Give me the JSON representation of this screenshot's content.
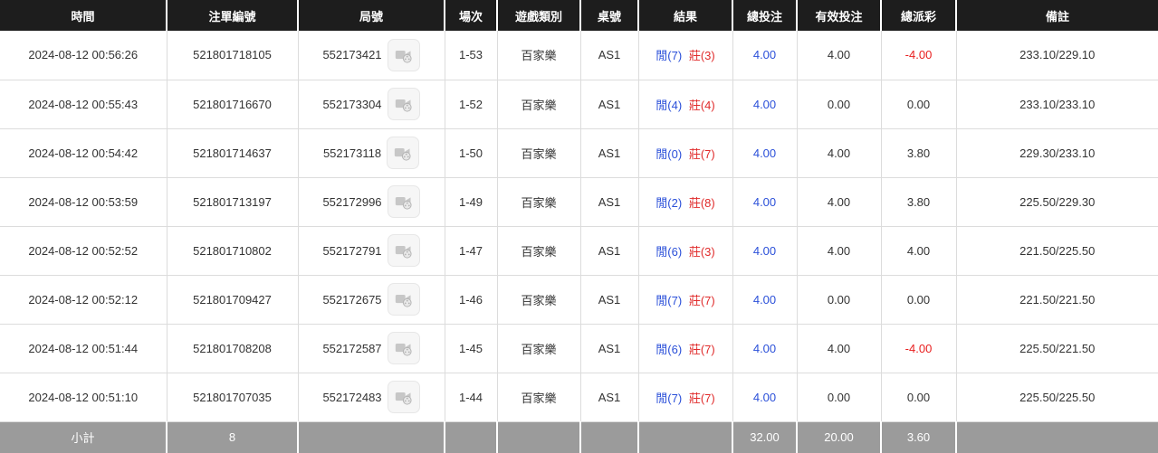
{
  "colors": {
    "header_bg": "#1d1d1d",
    "footer_bg": "#9b9b9b",
    "player_blue": "#2b50d9",
    "banker_red": "#e02b2b",
    "negative_red": "#e81e1e",
    "grid_line": "#dcdcdc"
  },
  "icons": {
    "video_replay": "video-camera-icon"
  },
  "table": {
    "columns": [
      {
        "label": "時間"
      },
      {
        "label": "注單編號"
      },
      {
        "label": "局號"
      },
      {
        "label": "場次"
      },
      {
        "label": "遊戲類別"
      },
      {
        "label": "桌號"
      },
      {
        "label": "結果"
      },
      {
        "label": "總投注"
      },
      {
        "label": "有效投注"
      },
      {
        "label": "總派彩"
      },
      {
        "label": "備註"
      }
    ],
    "rows": [
      {
        "time": "2024-08-12 00:56:26",
        "bet_id": "521801718105",
        "round_id": "552173421",
        "session": "1-53",
        "game_type": "百家樂",
        "table_no": "AS1",
        "result_player": "閒(7)",
        "result_banker": "莊(3)",
        "total_bet": "4.00",
        "valid_bet": "4.00",
        "total_payout": "-4.00",
        "remark": "233.10/229.10"
      },
      {
        "time": "2024-08-12 00:55:43",
        "bet_id": "521801716670",
        "round_id": "552173304",
        "session": "1-52",
        "game_type": "百家樂",
        "table_no": "AS1",
        "result_player": "閒(4)",
        "result_banker": "莊(4)",
        "total_bet": "4.00",
        "valid_bet": "0.00",
        "total_payout": "0.00",
        "remark": "233.10/233.10"
      },
      {
        "time": "2024-08-12 00:54:42",
        "bet_id": "521801714637",
        "round_id": "552173118",
        "session": "1-50",
        "game_type": "百家樂",
        "table_no": "AS1",
        "result_player": "閒(0)",
        "result_banker": "莊(7)",
        "total_bet": "4.00",
        "valid_bet": "4.00",
        "total_payout": "3.80",
        "remark": "229.30/233.10"
      },
      {
        "time": "2024-08-12 00:53:59",
        "bet_id": "521801713197",
        "round_id": "552172996",
        "session": "1-49",
        "game_type": "百家樂",
        "table_no": "AS1",
        "result_player": "閒(2)",
        "result_banker": "莊(8)",
        "total_bet": "4.00",
        "valid_bet": "4.00",
        "total_payout": "3.80",
        "remark": "225.50/229.30"
      },
      {
        "time": "2024-08-12 00:52:52",
        "bet_id": "521801710802",
        "round_id": "552172791",
        "session": "1-47",
        "game_type": "百家樂",
        "table_no": "AS1",
        "result_player": "閒(6)",
        "result_banker": "莊(3)",
        "total_bet": "4.00",
        "valid_bet": "4.00",
        "total_payout": "4.00",
        "remark": "221.50/225.50"
      },
      {
        "time": "2024-08-12 00:52:12",
        "bet_id": "521801709427",
        "round_id": "552172675",
        "session": "1-46",
        "game_type": "百家樂",
        "table_no": "AS1",
        "result_player": "閒(7)",
        "result_banker": "莊(7)",
        "total_bet": "4.00",
        "valid_bet": "0.00",
        "total_payout": "0.00",
        "remark": "221.50/221.50"
      },
      {
        "time": "2024-08-12 00:51:44",
        "bet_id": "521801708208",
        "round_id": "552172587",
        "session": "1-45",
        "game_type": "百家樂",
        "table_no": "AS1",
        "result_player": "閒(6)",
        "result_banker": "莊(7)",
        "total_bet": "4.00",
        "valid_bet": "4.00",
        "total_payout": "-4.00",
        "remark": "225.50/221.50"
      },
      {
        "time": "2024-08-12 00:51:10",
        "bet_id": "521801707035",
        "round_id": "552172483",
        "session": "1-44",
        "game_type": "百家樂",
        "table_no": "AS1",
        "result_player": "閒(7)",
        "result_banker": "莊(7)",
        "total_bet": "4.00",
        "valid_bet": "0.00",
        "total_payout": "0.00",
        "remark": "225.50/225.50"
      }
    ],
    "footer": {
      "label": "小計",
      "count": "8",
      "total_bet": "32.00",
      "valid_bet": "20.00",
      "total_payout": "3.60"
    }
  }
}
